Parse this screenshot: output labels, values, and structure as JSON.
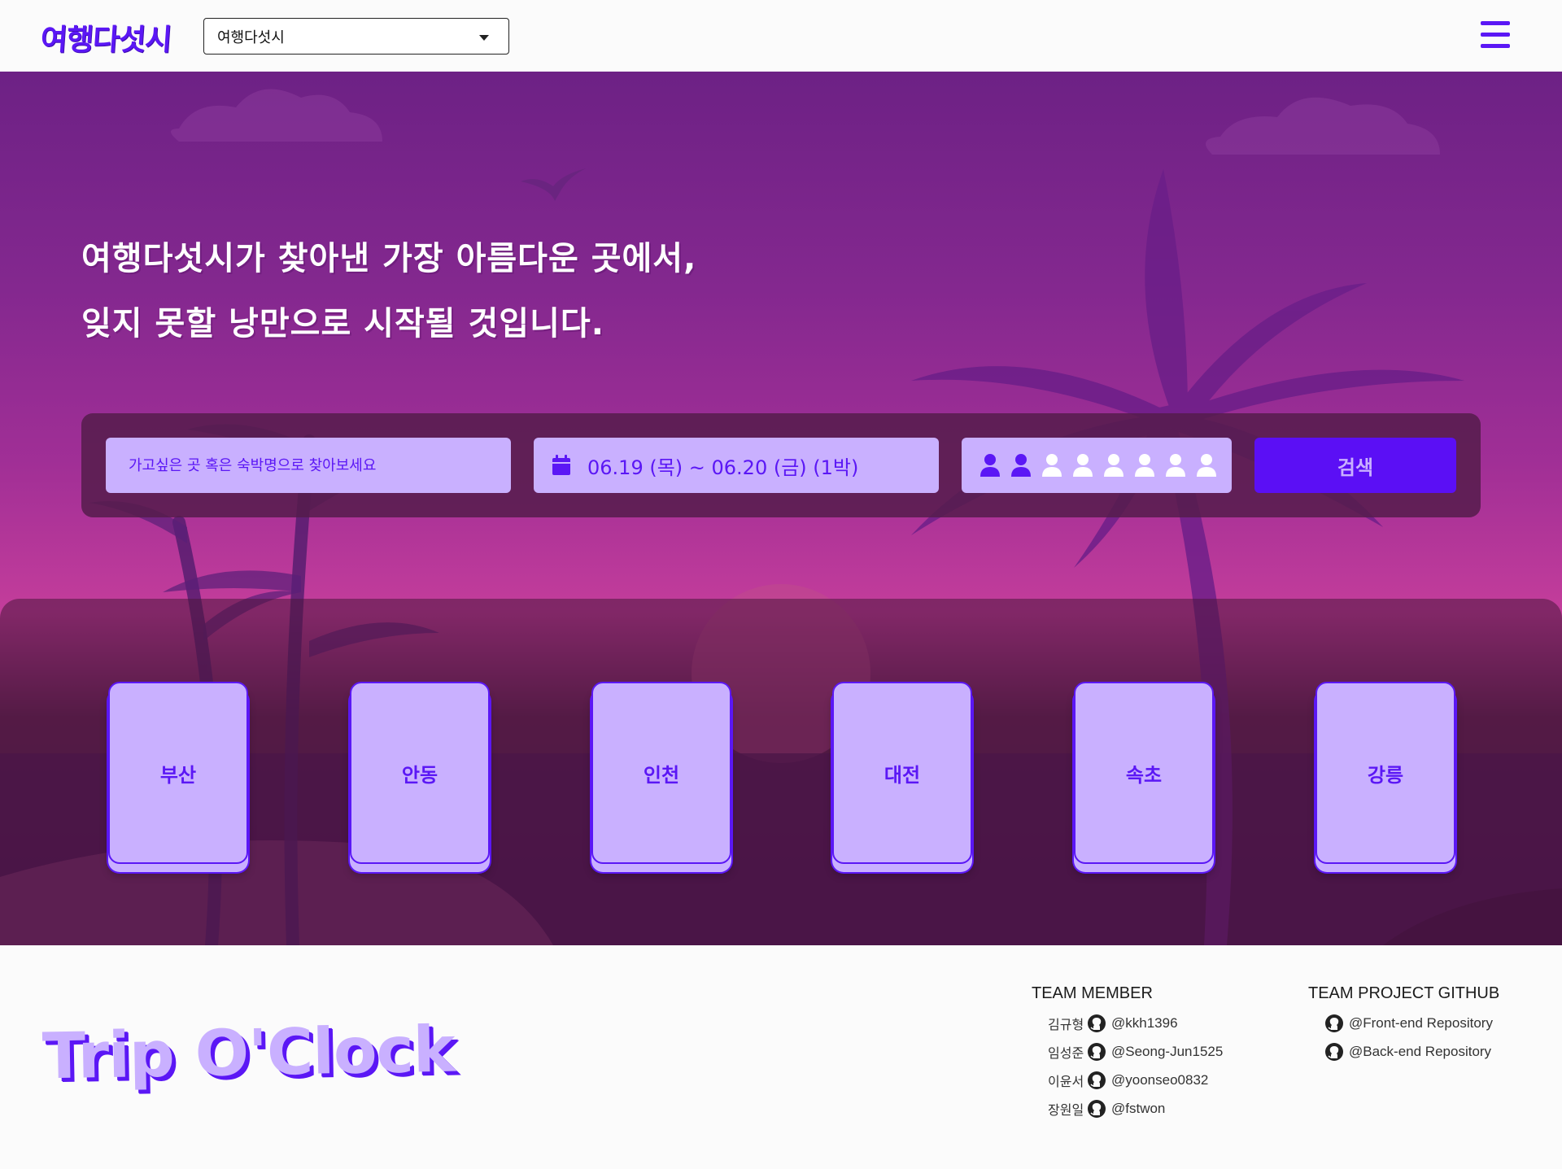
{
  "header": {
    "logo": "여행다섯시",
    "region_select": {
      "selected": "여행다섯시"
    }
  },
  "hero": {
    "headline_line1": "여행다섯시가 찾아낸 가장 아름다운 곳에서,",
    "headline_line2": "잊지 못할 낭만으로 시작될 것입니다."
  },
  "search": {
    "destination_placeholder": "가고싶은 곳 혹은 숙박명으로 찾아보세요",
    "date_range": "06.19 (목) ~ 06.20 (금) (1박)",
    "guests": {
      "selected": 2,
      "max": 8
    },
    "button_label": "검색"
  },
  "cities": [
    "부산",
    "안동",
    "인천",
    "대전",
    "속초",
    "강릉"
  ],
  "footer": {
    "brand": "Trip O'Clock",
    "team_title": "TEAM MEMBER",
    "members": [
      {
        "name": "김규형",
        "github": "@kkh1396"
      },
      {
        "name": "임성준",
        "github": "@Seong-Jun1525"
      },
      {
        "name": "이윤서",
        "github": "@yoonseo0832"
      },
      {
        "name": "장원일",
        "github": "@fstwon"
      }
    ],
    "github_title": "TEAM PROJECT GITHUB",
    "repos": [
      "@Front-end Repository",
      "@Back-end Repository"
    ]
  },
  "colors": {
    "accent": "#5b17f5",
    "accent_light": "#c9b0ff",
    "hero_top": "#6d2185",
    "hero_mid": "#c43d9b"
  }
}
